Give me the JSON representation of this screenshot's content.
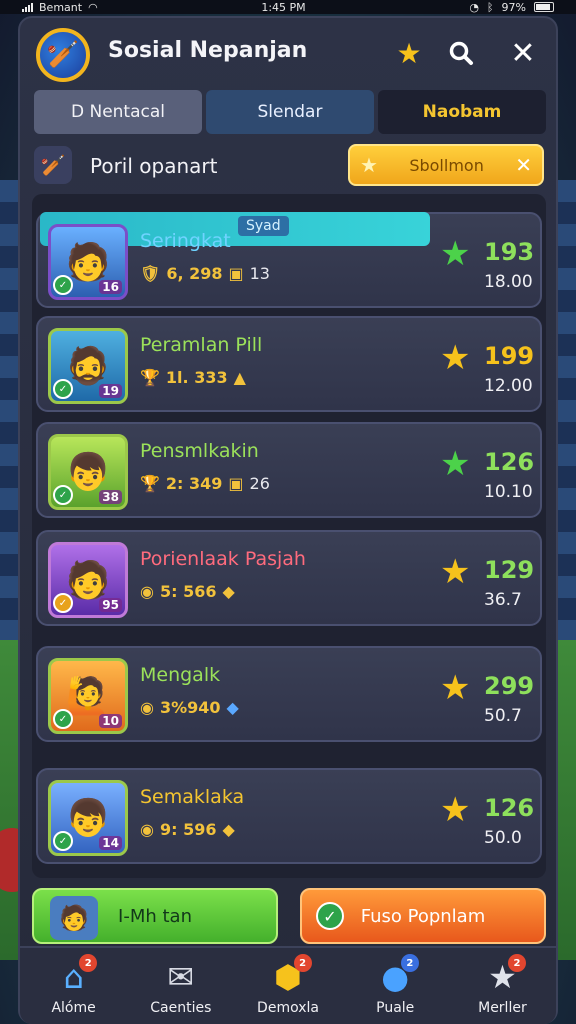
{
  "status_bar": {
    "carrier": "Bemant",
    "time": "1:45 PM",
    "battery": "97%"
  },
  "header": {
    "title": "Sosial Nepanjan"
  },
  "tabs": [
    {
      "label": "D Nentacal"
    },
    {
      "label": "Slendar"
    },
    {
      "label": "Naobam"
    }
  ],
  "subheader": {
    "title": "Poril opanart",
    "filter_label": "Sbollmon"
  },
  "entries": [
    {
      "name": "Seringkat",
      "banner_tag": "Syad",
      "stat": "6, 298",
      "extra": "13",
      "score": "193",
      "sub_score": "18.00",
      "level": "16",
      "name_color": "#6fd3ff"
    },
    {
      "name": "Peramlan Pill",
      "stat": "1l. 333",
      "extra": "",
      "score": "199",
      "sub_score": "12.00",
      "level": "19",
      "name_color": "#9be15a"
    },
    {
      "name": "Pensmlkakin",
      "stat": "2: 349",
      "extra": "26",
      "score": "126",
      "sub_score": "10.10",
      "level": "38",
      "name_color": "#9be15a"
    },
    {
      "name": "Porienlaak Pasjah",
      "stat": "5: 566",
      "extra": "",
      "score": "129",
      "sub_score": "36.7",
      "level": "95",
      "name_color": "#ff6b7d"
    },
    {
      "name": "Mengalk",
      "stat": "3%940",
      "extra": "",
      "score": "299",
      "sub_score": "50.7",
      "level": "10",
      "name_color": "#9be15a"
    },
    {
      "name": "Semaklaka",
      "stat": "9: 596",
      "extra": "",
      "score": "126",
      "sub_score": "50.0",
      "level": "14",
      "name_color": "#f4c530"
    }
  ],
  "actions": {
    "left_label": "I-Mh tan",
    "right_label": "Fuso Popnlam"
  },
  "nav": [
    {
      "label": "Alóme",
      "badge": "2"
    },
    {
      "label": "Caenties",
      "badge": ""
    },
    {
      "label": "Demoxla",
      "badge": "2"
    },
    {
      "label": "Puale",
      "badge": "2"
    },
    {
      "label": "Merller",
      "badge": "2"
    }
  ]
}
